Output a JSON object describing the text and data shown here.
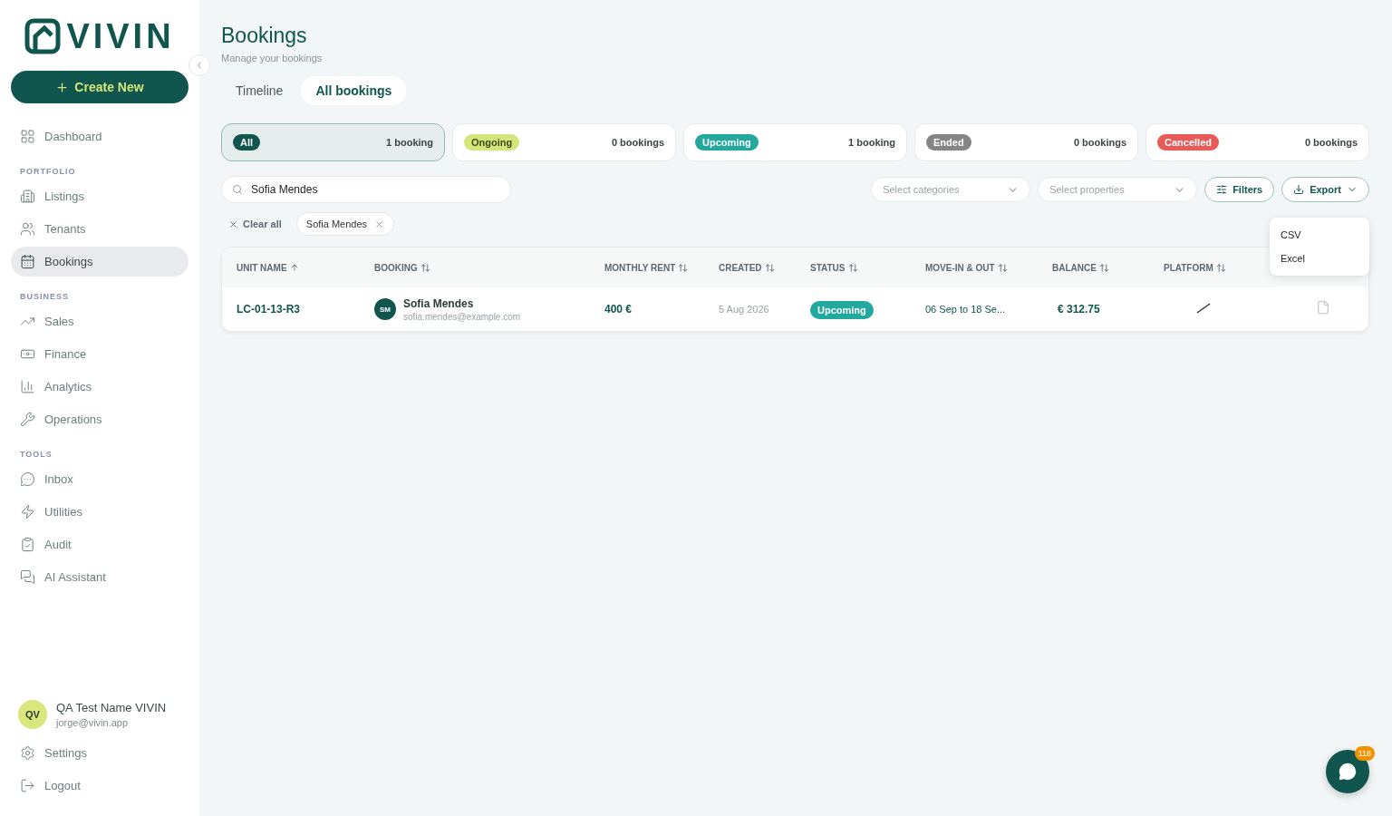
{
  "sidebar": {
    "logo": "VIVIN",
    "create_button": "Create New",
    "sections": [
      {
        "items": [
          {
            "label": "Dashboard",
            "selected": false
          }
        ]
      },
      {
        "heading": "PORTFOLIO",
        "items": [
          {
            "label": "Listings",
            "selected": false
          },
          {
            "label": "Tenants",
            "selected": false
          },
          {
            "label": "Bookings",
            "selected": true
          }
        ]
      },
      {
        "heading": "BUSINESS",
        "items": [
          {
            "label": "Sales",
            "selected": false
          },
          {
            "label": "Finance",
            "selected": false
          },
          {
            "label": "Analytics",
            "selected": false
          },
          {
            "label": "Operations",
            "selected": false
          }
        ]
      },
      {
        "heading": "TOOLS",
        "items": [
          {
            "label": "Inbox",
            "selected": false
          },
          {
            "label": "Utilities",
            "selected": false
          },
          {
            "label": "Audit",
            "selected": false
          },
          {
            "label": "AI Assistant",
            "selected": false
          }
        ]
      }
    ],
    "user": {
      "initials": "QV",
      "name": "QA Test Name VIVIN",
      "email": "jorge@vivin.app"
    },
    "footer_items": [
      "Settings",
      "Logout"
    ]
  },
  "page": {
    "title": "Bookings",
    "subtitle": "Manage your bookings"
  },
  "tabs": [
    {
      "label": "Timeline",
      "selected": false
    },
    {
      "label": "All bookings",
      "selected": true
    }
  ],
  "status_cards": [
    {
      "label": "All",
      "count": "1 booking",
      "color": "#10564f",
      "selected": true
    },
    {
      "label": "Ongoing",
      "count": "0 bookings",
      "color": "#d4e67a",
      "selected": false
    },
    {
      "label": "Upcoming",
      "count": "1 booking",
      "color": "#22a89c",
      "selected": false
    },
    {
      "label": "Ended",
      "count": "0 bookings",
      "color": "#858585",
      "selected": false
    },
    {
      "label": "Cancelled",
      "count": "0 bookings",
      "color": "#e85a57",
      "selected": false
    }
  ],
  "search": {
    "value": "Sofia Mendes"
  },
  "selects": [
    {
      "placeholder": "Select categories"
    },
    {
      "placeholder": "Select properties"
    }
  ],
  "filters_button": "Filters",
  "export_button": {
    "label": "Export",
    "expanded": true,
    "options": [
      "CSV",
      "Excel"
    ]
  },
  "clear_all": "Clear all",
  "chips": [
    "Sofia Mendes"
  ],
  "table": {
    "columns": [
      {
        "label": "UNIT NAME",
        "sorted": true
      },
      {
        "label": "BOOKING",
        "sorted": false
      },
      {
        "label": "MONTHLY RENT",
        "sorted": false
      },
      {
        "label": "CREATED",
        "sorted": false
      },
      {
        "label": "STATUS",
        "sorted": false
      },
      {
        "label": "MOVE-IN & OUT",
        "sorted": false
      },
      {
        "label": "BALANCE",
        "sorted": false
      },
      {
        "label": "PLATFORM",
        "sorted": false
      }
    ],
    "rows": [
      {
        "unit": "LC-01-13-R3",
        "initials": "SM",
        "name": "Sofia Mendes",
        "email": "sofia.mendes@example.com",
        "rent": "400 €",
        "created": "5 Aug 2026",
        "status": {
          "label": "Upcoming",
          "color": "#22a89c"
        },
        "dates": "06 Sep to 18 Se...",
        "balance": "€ 312.75"
      }
    ]
  },
  "chat": {
    "badge": "118"
  }
}
